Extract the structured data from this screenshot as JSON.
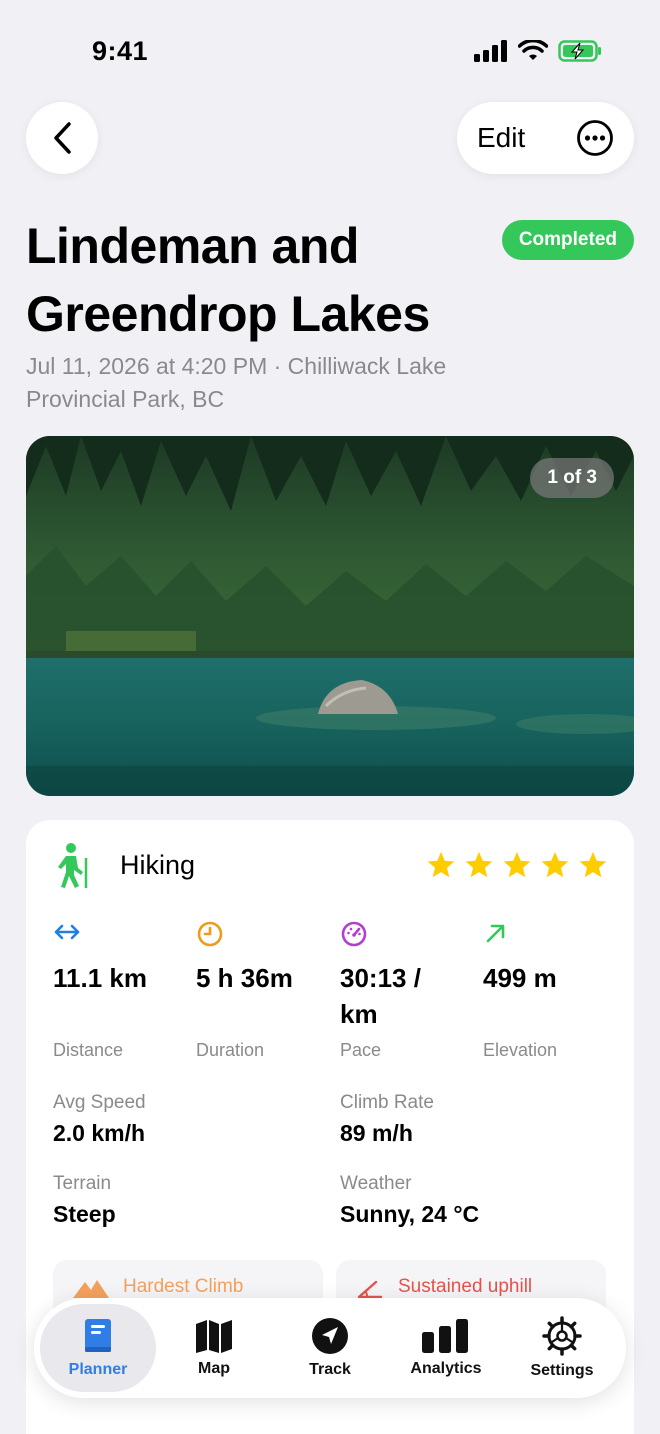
{
  "status": {
    "time": "9:41"
  },
  "nav": {
    "edit_label": "Edit"
  },
  "hike": {
    "title": "Lindeman and Greendrop Lakes",
    "badge": "Completed",
    "subtitle": "Jul 11, 2026 at 4:20 PM · Chilliwack Lake Provincial Park, BC"
  },
  "photo": {
    "counter": "1 of 3"
  },
  "card": {
    "activity": "Hiking",
    "rating": 5,
    "stats": [
      {
        "value": "11.1 km",
        "label": "Distance",
        "icon": "arrows-horizontal-icon",
        "color": "#1e7fe6"
      },
      {
        "value": "5 h 36m",
        "label": "Duration",
        "icon": "clock-icon",
        "color": "#f09a1a"
      },
      {
        "value": "30:13 / km",
        "label": "Pace",
        "icon": "speedometer-icon",
        "color": "#b23fd0"
      },
      {
        "value": "499 m",
        "label": "Elevation",
        "icon": "arrow-up-right-icon",
        "color": "#34c759"
      }
    ],
    "details": [
      {
        "label": "Avg Speed",
        "value": "2.0 km/h"
      },
      {
        "label": "Climb Rate",
        "value": "89 m/h"
      },
      {
        "label": "Terrain",
        "value": "Steep"
      },
      {
        "label": "Weather",
        "value": "Sunny, 24 °C"
      }
    ],
    "highlights": [
      {
        "label": "Hardest Climb",
        "color": "#f4a15d"
      },
      {
        "label": "Sustained uphill",
        "color": "#e5534b"
      }
    ]
  },
  "tabs": [
    {
      "label": "Planner",
      "icon": "book-icon",
      "active": true
    },
    {
      "label": "Map",
      "icon": "map-icon",
      "active": false
    },
    {
      "label": "Track",
      "icon": "location-arrow-icon",
      "active": false
    },
    {
      "label": "Analytics",
      "icon": "bar-chart-icon",
      "active": false
    },
    {
      "label": "Settings",
      "icon": "gear-icon",
      "active": false
    }
  ]
}
